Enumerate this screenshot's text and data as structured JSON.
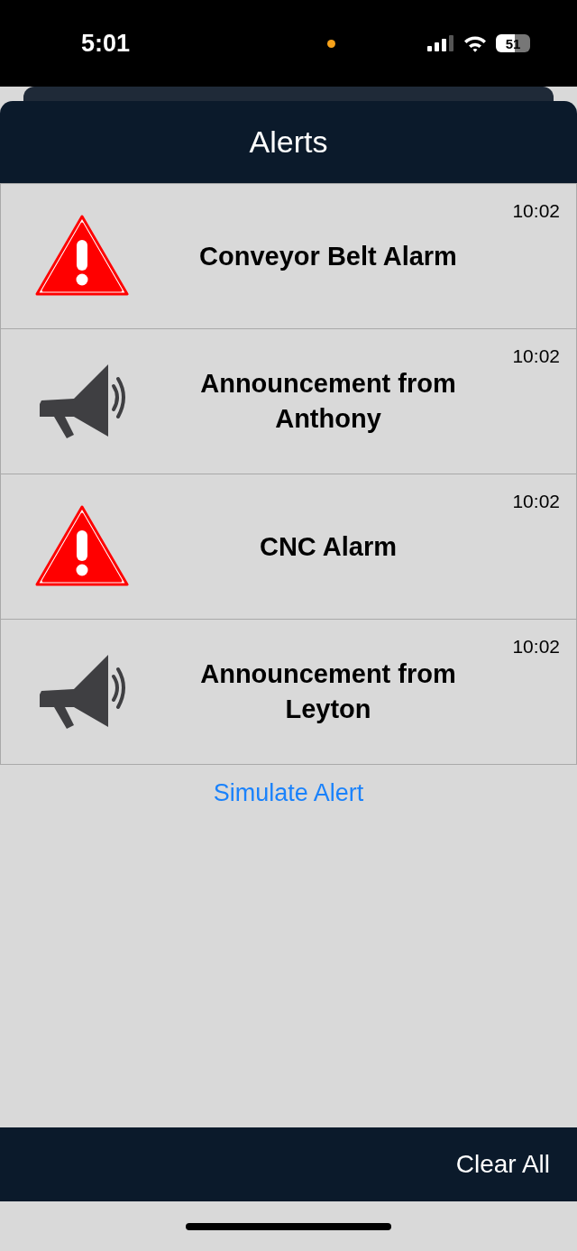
{
  "status_bar": {
    "time": "5:01",
    "battery": "51"
  },
  "header": {
    "title": "Alerts"
  },
  "alerts": [
    {
      "kind": "alarm",
      "title": "Conveyor Belt Alarm",
      "time": "10:02"
    },
    {
      "kind": "announcement",
      "title": "Announcement from Anthony",
      "time": "10:02"
    },
    {
      "kind": "alarm",
      "title": "CNC Alarm",
      "time": "10:02"
    },
    {
      "kind": "announcement",
      "title": "Announcement from Leyton",
      "time": "10:02"
    }
  ],
  "simulate_link": "Simulate Alert",
  "footer": {
    "button": "Clear All"
  }
}
